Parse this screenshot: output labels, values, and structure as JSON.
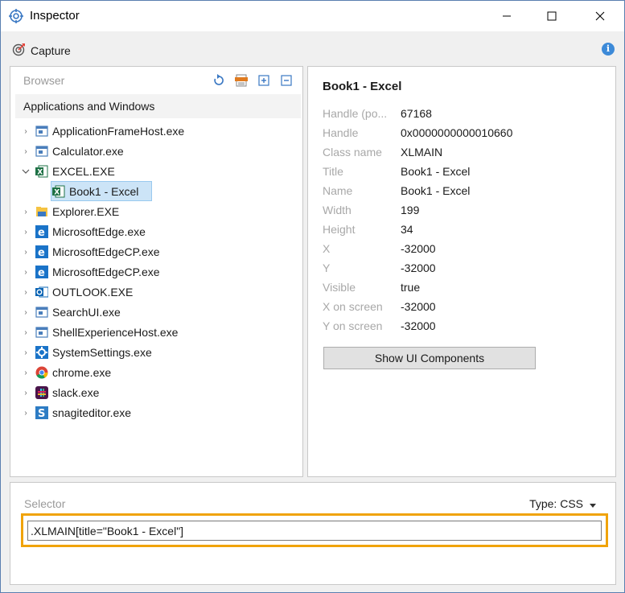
{
  "window": {
    "title": "Inspector"
  },
  "toolbar": {
    "capture_label": "Capture"
  },
  "browser": {
    "label": "Browser",
    "section_title": "Applications and Windows",
    "tree": [
      {
        "label": "ApplicationFrameHost.exe",
        "icon": "window-icon",
        "expanded": false
      },
      {
        "label": "Calculator.exe",
        "icon": "window-icon",
        "expanded": false
      },
      {
        "label": "EXCEL.EXE",
        "icon": "excel-icon",
        "expanded": true
      },
      {
        "label": "Book1 - Excel",
        "icon": "excel-icon",
        "child": true,
        "selected": true
      },
      {
        "label": "Explorer.EXE",
        "icon": "folder-icon",
        "expanded": false
      },
      {
        "label": "MicrosoftEdge.exe",
        "icon": "edge-icon",
        "expanded": false
      },
      {
        "label": "MicrosoftEdgeCP.exe",
        "icon": "edge-icon",
        "expanded": false
      },
      {
        "label": "MicrosoftEdgeCP.exe",
        "icon": "edge-icon",
        "expanded": false
      },
      {
        "label": "OUTLOOK.EXE",
        "icon": "outlook-icon",
        "expanded": false
      },
      {
        "label": "SearchUI.exe",
        "icon": "window-icon",
        "expanded": false
      },
      {
        "label": "ShellExperienceHost.exe",
        "icon": "window-icon",
        "expanded": false
      },
      {
        "label": "SystemSettings.exe",
        "icon": "gear-icon",
        "expanded": false
      },
      {
        "label": "chrome.exe",
        "icon": "chrome-icon",
        "expanded": false
      },
      {
        "label": "slack.exe",
        "icon": "slack-icon",
        "expanded": false
      },
      {
        "label": "snagiteditor.exe",
        "icon": "snagit-icon",
        "expanded": false
      }
    ]
  },
  "details": {
    "title": "Book1 - Excel",
    "properties": [
      {
        "key": "Handle (po...",
        "value": "67168"
      },
      {
        "key": "Handle",
        "value": "0x0000000000010660"
      },
      {
        "key": "Class name",
        "value": "XLMAIN"
      },
      {
        "key": "Title",
        "value": "Book1 - Excel"
      },
      {
        "key": "Name",
        "value": "Book1 - Excel"
      },
      {
        "key": "Width",
        "value": "199"
      },
      {
        "key": "Height",
        "value": "34"
      },
      {
        "key": "X",
        "value": "-32000"
      },
      {
        "key": "Y",
        "value": "-32000"
      },
      {
        "key": "Visible",
        "value": "true"
      },
      {
        "key": "X on screen",
        "value": "-32000"
      },
      {
        "key": "Y on screen",
        "value": "-32000"
      }
    ],
    "show_button_label": "Show UI Components"
  },
  "selector": {
    "label": "Selector",
    "type_label": "Type: CSS",
    "value": ".XLMAIN[title=\"Book1 - Excel\"]"
  },
  "colors": {
    "accent_outline": "#f0a30a",
    "selection": "#cce4f7",
    "info": "#3d8ad8"
  }
}
